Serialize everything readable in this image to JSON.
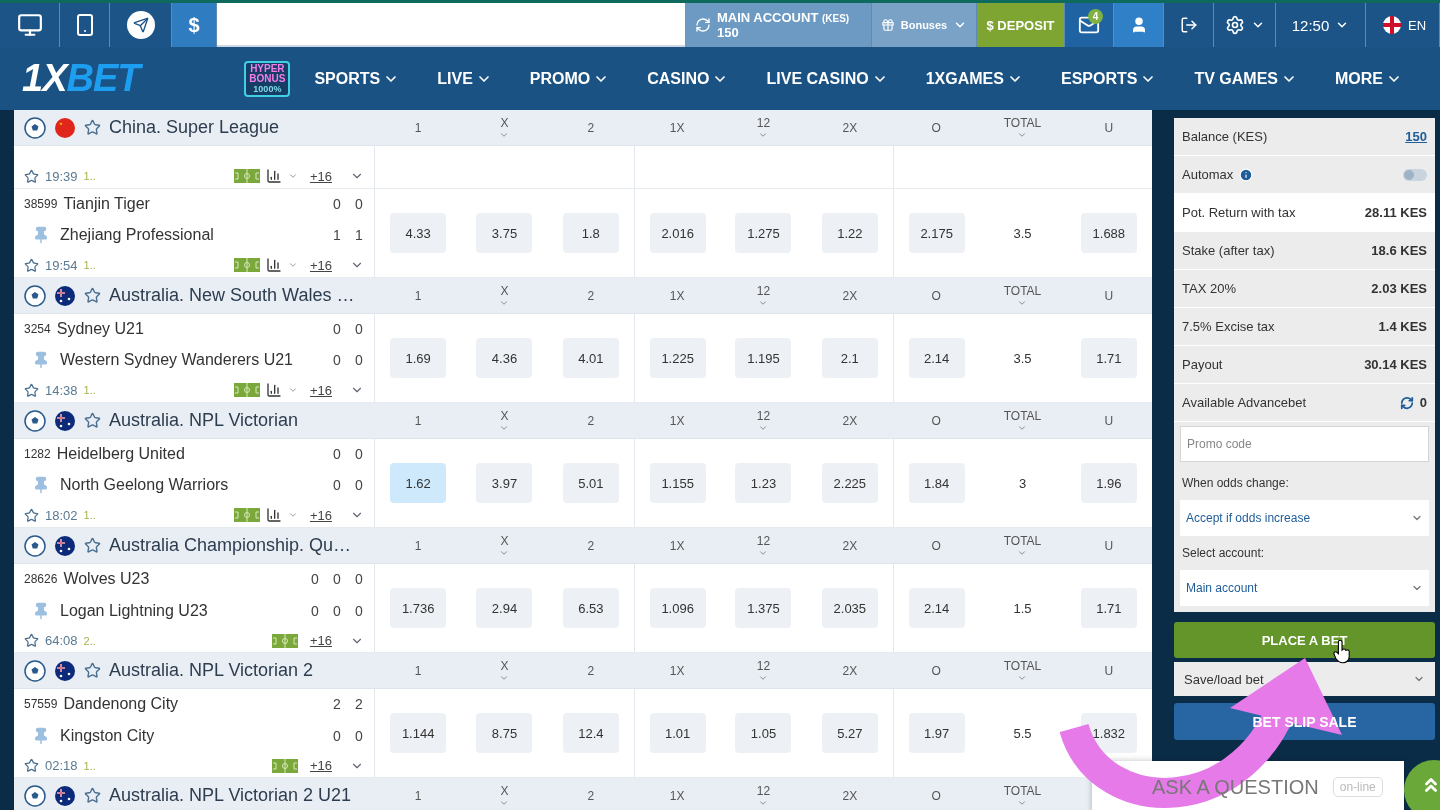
{
  "top_bar": {
    "currency_symbol": "$",
    "account": {
      "label": "MAIN ACCOUNT",
      "currency": "(KES)",
      "balance": "150"
    },
    "bonuses": "Bonuses",
    "deposit": "$ DEPOSIT",
    "mail_badge": "4",
    "time": "12:50",
    "language": "EN"
  },
  "nav": {
    "logo": {
      "part1": "1X",
      "part2": "BET"
    },
    "promo_badge": {
      "line1": "HYPER",
      "line2": "BONUS",
      "line3": "1000%"
    },
    "items": [
      "SPORTS",
      "LIVE",
      "PROMO",
      "CASINO",
      "LIVE CASINO",
      "1XGAMES",
      "ESPORTS",
      "TV GAMES",
      "MORE"
    ]
  },
  "leagues": [
    {
      "name": "China. Super League",
      "kind": "china",
      "columns": [
        {
          "label": "1",
          "caret": false
        },
        {
          "label": "X",
          "caret": true
        },
        {
          "label": "2",
          "caret": false
        },
        {
          "label": "1X",
          "caret": false
        },
        {
          "label": "12",
          "caret": true
        },
        {
          "label": "2X",
          "caret": false
        },
        {
          "label": "O",
          "caret": false
        },
        {
          "label": "TOTAL",
          "caret": true
        },
        {
          "label": "U",
          "caret": false
        }
      ],
      "matches": [
        {
          "kind": "cut",
          "time": "19:39",
          "period": "1..",
          "stats": true,
          "more": "+16"
        },
        {
          "kind": "full",
          "id": "38599",
          "home": "Tianjin Tiger",
          "away": "Zhejiang Professional",
          "home_score": [
            "0",
            "0"
          ],
          "away_score": [
            "1",
            "1"
          ],
          "time": "19:54",
          "period": "1..",
          "stats": true,
          "more": "+16",
          "odds": [
            {
              "value": "4.33",
              "selected": false
            },
            {
              "value": "3.75",
              "selected": false
            },
            {
              "value": "1.8",
              "selected": false
            },
            {
              "value": "2.016",
              "selected": false
            },
            {
              "value": "1.275",
              "selected": false
            },
            {
              "value": "1.22",
              "selected": false
            },
            {
              "value": "2.175",
              "selected": false
            },
            {
              "value": "3.5",
              "selected": false
            },
            {
              "value": "1.688",
              "selected": false
            }
          ]
        }
      ]
    },
    {
      "name": "Australia. New South Wales …",
      "kind": "australia",
      "columns": [
        {
          "label": "1",
          "caret": false
        },
        {
          "label": "X",
          "caret": true
        },
        {
          "label": "2",
          "caret": false
        },
        {
          "label": "1X",
          "caret": false
        },
        {
          "label": "12",
          "caret": true
        },
        {
          "label": "2X",
          "caret": false
        },
        {
          "label": "O",
          "caret": false
        },
        {
          "label": "TOTAL",
          "caret": true
        },
        {
          "label": "U",
          "caret": false
        }
      ],
      "matches": [
        {
          "kind": "full",
          "id": "3254",
          "home": "Sydney U21",
          "away": "Western Sydney Wanderers U21",
          "home_score": [
            "0",
            "0"
          ],
          "away_score": [
            "0",
            "0"
          ],
          "time": "14:38",
          "period": "1..",
          "stats": true,
          "more": "+16",
          "odds": [
            {
              "value": "1.69",
              "selected": false
            },
            {
              "value": "4.36",
              "selected": false
            },
            {
              "value": "4.01",
              "selected": false
            },
            {
              "value": "1.225",
              "selected": false
            },
            {
              "value": "1.195",
              "selected": false
            },
            {
              "value": "2.1",
              "selected": false
            },
            {
              "value": "2.14",
              "selected": false
            },
            {
              "value": "3.5",
              "selected": false
            },
            {
              "value": "1.71",
              "selected": false
            }
          ]
        }
      ]
    },
    {
      "name": "Australia. NPL Victorian",
      "kind": "australia",
      "columns": [
        {
          "label": "1",
          "caret": false
        },
        {
          "label": "X",
          "caret": true
        },
        {
          "label": "2",
          "caret": false
        },
        {
          "label": "1X",
          "caret": false
        },
        {
          "label": "12",
          "caret": true
        },
        {
          "label": "2X",
          "caret": false
        },
        {
          "label": "O",
          "caret": false
        },
        {
          "label": "TOTAL",
          "caret": true
        },
        {
          "label": "U",
          "caret": false
        }
      ],
      "matches": [
        {
          "kind": "full",
          "id": "1282",
          "home": "Heidelberg United",
          "away": "North Geelong Warriors",
          "home_score": [
            "0",
            "0"
          ],
          "away_score": [
            "0",
            "0"
          ],
          "time": "18:02",
          "period": "1..",
          "stats": true,
          "more": "+16",
          "odds": [
            {
              "value": "1.62",
              "selected": true
            },
            {
              "value": "3.97",
              "selected": false
            },
            {
              "value": "5.01",
              "selected": false
            },
            {
              "value": "1.155",
              "selected": false
            },
            {
              "value": "1.23",
              "selected": false
            },
            {
              "value": "2.225",
              "selected": false
            },
            {
              "value": "1.84",
              "selected": false
            },
            {
              "value": "3",
              "selected": false
            },
            {
              "value": "1.96",
              "selected": false
            }
          ]
        }
      ]
    },
    {
      "name": "Australia Championship. Qu…",
      "kind": "australia",
      "columns": [
        {
          "label": "1",
          "caret": false
        },
        {
          "label": "X",
          "caret": true
        },
        {
          "label": "2",
          "caret": false
        },
        {
          "label": "1X",
          "caret": false
        },
        {
          "label": "12",
          "caret": true
        },
        {
          "label": "2X",
          "caret": false
        },
        {
          "label": "O",
          "caret": false
        },
        {
          "label": "TOTAL",
          "caret": true
        },
        {
          "label": "U",
          "caret": false
        }
      ],
      "matches": [
        {
          "kind": "full",
          "id": "28626",
          "home": "Wolves U23",
          "away": "Logan Lightning U23",
          "home_score": [
            "0",
            "0",
            "0"
          ],
          "away_score": [
            "0",
            "0",
            "0"
          ],
          "time": "64:08",
          "period": "2..",
          "stats": false,
          "more": "+16",
          "odds": [
            {
              "value": "1.736",
              "selected": false
            },
            {
              "value": "2.94",
              "selected": false
            },
            {
              "value": "6.53",
              "selected": false
            },
            {
              "value": "1.096",
              "selected": false
            },
            {
              "value": "1.375",
              "selected": false
            },
            {
              "value": "2.035",
              "selected": false
            },
            {
              "value": "2.14",
              "selected": false
            },
            {
              "value": "1.5",
              "selected": false
            },
            {
              "value": "1.71",
              "selected": false
            }
          ]
        }
      ]
    },
    {
      "name": "Australia. NPL Victorian 2",
      "kind": "australia",
      "columns": [
        {
          "label": "1",
          "caret": false
        },
        {
          "label": "X",
          "caret": true
        },
        {
          "label": "2",
          "caret": false
        },
        {
          "label": "1X",
          "caret": false
        },
        {
          "label": "12",
          "caret": true
        },
        {
          "label": "2X",
          "caret": false
        },
        {
          "label": "O",
          "caret": false
        },
        {
          "label": "TOTAL",
          "caret": true
        },
        {
          "label": "U",
          "caret": false
        }
      ],
      "matches": [
        {
          "kind": "full",
          "id": "57559",
          "home": "Dandenong City",
          "away": "Kingston City",
          "home_score": [
            "2",
            "2"
          ],
          "away_score": [
            "0",
            "0"
          ],
          "time": "02:18",
          "period": "1..",
          "stats": false,
          "more": "+16",
          "odds": [
            {
              "value": "1.144",
              "selected": false
            },
            {
              "value": "8.75",
              "selected": false
            },
            {
              "value": "12.4",
              "selected": false
            },
            {
              "value": "1.01",
              "selected": false
            },
            {
              "value": "1.05",
              "selected": false
            },
            {
              "value": "5.27",
              "selected": false
            },
            {
              "value": "1.97",
              "selected": false
            },
            {
              "value": "5.5",
              "selected": false
            },
            {
              "value": "1.832",
              "selected": false
            }
          ]
        }
      ]
    },
    {
      "name": "Australia. NPL Victorian 2 U21",
      "kind": "australia",
      "columns": [
        {
          "label": "1",
          "caret": false
        },
        {
          "label": "X",
          "caret": true
        },
        {
          "label": "2",
          "caret": false
        },
        {
          "label": "1X",
          "caret": false
        },
        {
          "label": "12",
          "caret": true
        },
        {
          "label": "2X",
          "caret": false
        },
        {
          "label": "O",
          "caret": false
        },
        {
          "label": "TOTAL",
          "caret": true
        }
      ]
    }
  ],
  "bet_slip": {
    "rows": [
      {
        "kind": "link",
        "label": "Balance (KES)",
        "value": "150",
        "highlight": false
      },
      {
        "kind": "toggle",
        "label": "Automax",
        "on": false,
        "highlight": false
      },
      {
        "kind": "value",
        "label": "Pot. Return with tax",
        "value": "28.11 KES",
        "highlight": true
      },
      {
        "kind": "value",
        "label": "Stake (after tax)",
        "value": "18.6 KES",
        "highlight": false
      },
      {
        "kind": "value",
        "label": "TAX 20%",
        "value": "2.03 KES",
        "highlight": false
      },
      {
        "kind": "value",
        "label": "7.5% Excise tax",
        "value": "1.4 KES",
        "highlight": false
      },
      {
        "kind": "value",
        "label": "Payout",
        "value": "30.14 KES",
        "highlight": false
      },
      {
        "kind": "refresh",
        "label": "Available Advancebet",
        "value": "0",
        "highlight": false
      }
    ],
    "promo_placeholder": "Promo code",
    "odds_change_label": "When odds change:",
    "odds_change_value": "Accept if odds increase",
    "account_label": "Select account:",
    "account_value": "Main account",
    "place_bet": "PLACE A BET",
    "save_load": "Save/load bet",
    "sale_button": "BET SLIP SALE"
  },
  "chat": {
    "label": "ASK A QUESTION",
    "status": "on-line"
  }
}
